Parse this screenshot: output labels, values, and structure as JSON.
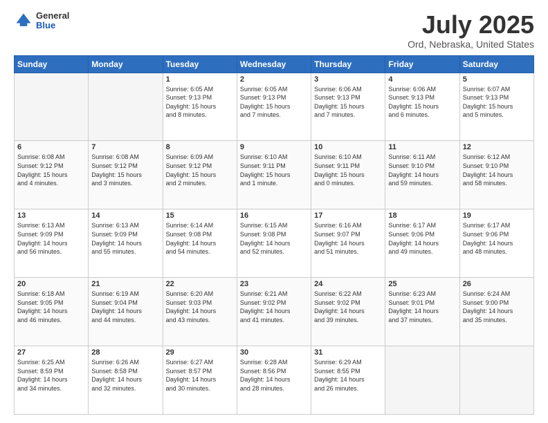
{
  "header": {
    "logo_general": "General",
    "logo_blue": "Blue",
    "title": "July 2025",
    "subtitle": "Ord, Nebraska, United States"
  },
  "weekdays": [
    "Sunday",
    "Monday",
    "Tuesday",
    "Wednesday",
    "Thursday",
    "Friday",
    "Saturday"
  ],
  "weeks": [
    [
      {
        "day": "",
        "info": ""
      },
      {
        "day": "",
        "info": ""
      },
      {
        "day": "1",
        "info": "Sunrise: 6:05 AM\nSunset: 9:13 PM\nDaylight: 15 hours\nand 8 minutes."
      },
      {
        "day": "2",
        "info": "Sunrise: 6:05 AM\nSunset: 9:13 PM\nDaylight: 15 hours\nand 7 minutes."
      },
      {
        "day": "3",
        "info": "Sunrise: 6:06 AM\nSunset: 9:13 PM\nDaylight: 15 hours\nand 7 minutes."
      },
      {
        "day": "4",
        "info": "Sunrise: 6:06 AM\nSunset: 9:13 PM\nDaylight: 15 hours\nand 6 minutes."
      },
      {
        "day": "5",
        "info": "Sunrise: 6:07 AM\nSunset: 9:13 PM\nDaylight: 15 hours\nand 5 minutes."
      }
    ],
    [
      {
        "day": "6",
        "info": "Sunrise: 6:08 AM\nSunset: 9:12 PM\nDaylight: 15 hours\nand 4 minutes."
      },
      {
        "day": "7",
        "info": "Sunrise: 6:08 AM\nSunset: 9:12 PM\nDaylight: 15 hours\nand 3 minutes."
      },
      {
        "day": "8",
        "info": "Sunrise: 6:09 AM\nSunset: 9:12 PM\nDaylight: 15 hours\nand 2 minutes."
      },
      {
        "day": "9",
        "info": "Sunrise: 6:10 AM\nSunset: 9:11 PM\nDaylight: 15 hours\nand 1 minute."
      },
      {
        "day": "10",
        "info": "Sunrise: 6:10 AM\nSunset: 9:11 PM\nDaylight: 15 hours\nand 0 minutes."
      },
      {
        "day": "11",
        "info": "Sunrise: 6:11 AM\nSunset: 9:10 PM\nDaylight: 14 hours\nand 59 minutes."
      },
      {
        "day": "12",
        "info": "Sunrise: 6:12 AM\nSunset: 9:10 PM\nDaylight: 14 hours\nand 58 minutes."
      }
    ],
    [
      {
        "day": "13",
        "info": "Sunrise: 6:13 AM\nSunset: 9:09 PM\nDaylight: 14 hours\nand 56 minutes."
      },
      {
        "day": "14",
        "info": "Sunrise: 6:13 AM\nSunset: 9:09 PM\nDaylight: 14 hours\nand 55 minutes."
      },
      {
        "day": "15",
        "info": "Sunrise: 6:14 AM\nSunset: 9:08 PM\nDaylight: 14 hours\nand 54 minutes."
      },
      {
        "day": "16",
        "info": "Sunrise: 6:15 AM\nSunset: 9:08 PM\nDaylight: 14 hours\nand 52 minutes."
      },
      {
        "day": "17",
        "info": "Sunrise: 6:16 AM\nSunset: 9:07 PM\nDaylight: 14 hours\nand 51 minutes."
      },
      {
        "day": "18",
        "info": "Sunrise: 6:17 AM\nSunset: 9:06 PM\nDaylight: 14 hours\nand 49 minutes."
      },
      {
        "day": "19",
        "info": "Sunrise: 6:17 AM\nSunset: 9:06 PM\nDaylight: 14 hours\nand 48 minutes."
      }
    ],
    [
      {
        "day": "20",
        "info": "Sunrise: 6:18 AM\nSunset: 9:05 PM\nDaylight: 14 hours\nand 46 minutes."
      },
      {
        "day": "21",
        "info": "Sunrise: 6:19 AM\nSunset: 9:04 PM\nDaylight: 14 hours\nand 44 minutes."
      },
      {
        "day": "22",
        "info": "Sunrise: 6:20 AM\nSunset: 9:03 PM\nDaylight: 14 hours\nand 43 minutes."
      },
      {
        "day": "23",
        "info": "Sunrise: 6:21 AM\nSunset: 9:02 PM\nDaylight: 14 hours\nand 41 minutes."
      },
      {
        "day": "24",
        "info": "Sunrise: 6:22 AM\nSunset: 9:02 PM\nDaylight: 14 hours\nand 39 minutes."
      },
      {
        "day": "25",
        "info": "Sunrise: 6:23 AM\nSunset: 9:01 PM\nDaylight: 14 hours\nand 37 minutes."
      },
      {
        "day": "26",
        "info": "Sunrise: 6:24 AM\nSunset: 9:00 PM\nDaylight: 14 hours\nand 35 minutes."
      }
    ],
    [
      {
        "day": "27",
        "info": "Sunrise: 6:25 AM\nSunset: 8:59 PM\nDaylight: 14 hours\nand 34 minutes."
      },
      {
        "day": "28",
        "info": "Sunrise: 6:26 AM\nSunset: 8:58 PM\nDaylight: 14 hours\nand 32 minutes."
      },
      {
        "day": "29",
        "info": "Sunrise: 6:27 AM\nSunset: 8:57 PM\nDaylight: 14 hours\nand 30 minutes."
      },
      {
        "day": "30",
        "info": "Sunrise: 6:28 AM\nSunset: 8:56 PM\nDaylight: 14 hours\nand 28 minutes."
      },
      {
        "day": "31",
        "info": "Sunrise: 6:29 AM\nSunset: 8:55 PM\nDaylight: 14 hours\nand 26 minutes."
      },
      {
        "day": "",
        "info": ""
      },
      {
        "day": "",
        "info": ""
      }
    ]
  ]
}
